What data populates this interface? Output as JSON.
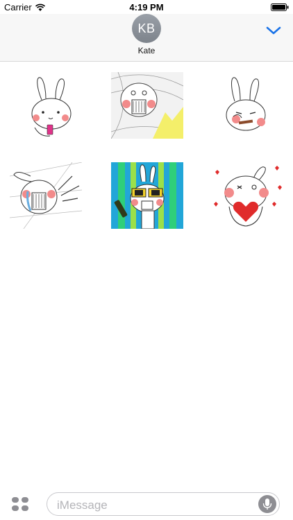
{
  "status_bar": {
    "carrier": "Carrier",
    "time": "4:19 PM",
    "icons": [
      "wifi-icon",
      "battery-icon"
    ]
  },
  "header": {
    "avatar_initials": "KB",
    "contact_name": "Kate",
    "collapse_icon": "chevron-down-icon",
    "accent_color": "#1a73e8"
  },
  "stickers": [
    {
      "name": "bunny-waving-phone",
      "row": 1,
      "col": 1
    },
    {
      "name": "bunny-screaming-swirl",
      "row": 1,
      "col": 2
    },
    {
      "name": "bunny-smoking-cigar",
      "row": 1,
      "col": 3
    },
    {
      "name": "bunny-crying-reaching",
      "row": 2,
      "col": 1
    },
    {
      "name": "bunny-sunglasses-champagne",
      "row": 2,
      "col": 2
    },
    {
      "name": "bunny-heart-hands",
      "row": 2,
      "col": 3
    }
  ],
  "input_bar": {
    "apps_icon": "apps-icon",
    "placeholder": "iMessage",
    "mic_icon": "microphone-icon"
  }
}
